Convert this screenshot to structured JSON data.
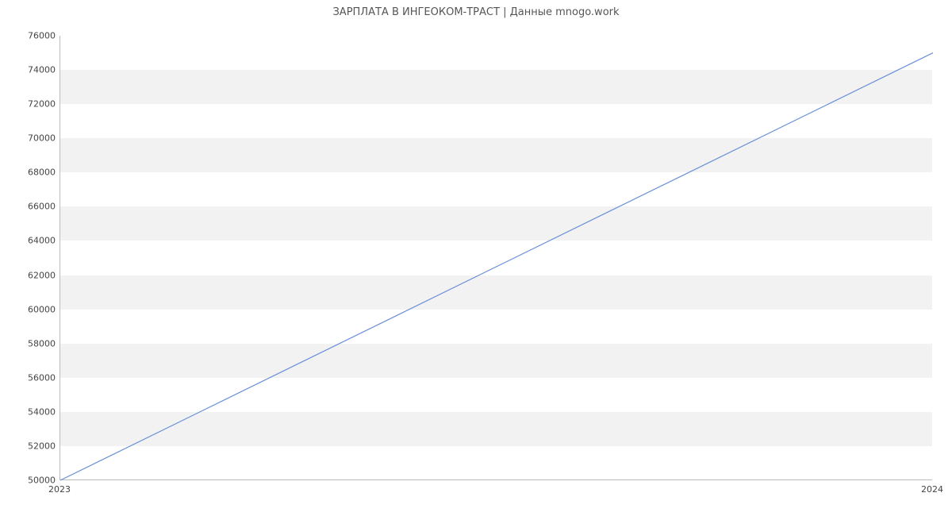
{
  "chart_data": {
    "type": "line",
    "title": "ЗАРПЛАТА В ИНГЕОКОМ-ТРАСТ | Данные mnogo.work",
    "x": [
      "2023",
      "2024"
    ],
    "values": [
      50000,
      75000
    ],
    "xlabel": "",
    "ylabel": "",
    "y_ticks": [
      50000,
      52000,
      54000,
      56000,
      58000,
      60000,
      62000,
      64000,
      66000,
      68000,
      70000,
      72000,
      74000,
      76000
    ],
    "x_ticks": [
      "2023",
      "2024"
    ],
    "ylim": [
      50000,
      76000
    ],
    "line_color": "#6a8fd8",
    "band_color": "#f2f2f2",
    "grid": true
  }
}
